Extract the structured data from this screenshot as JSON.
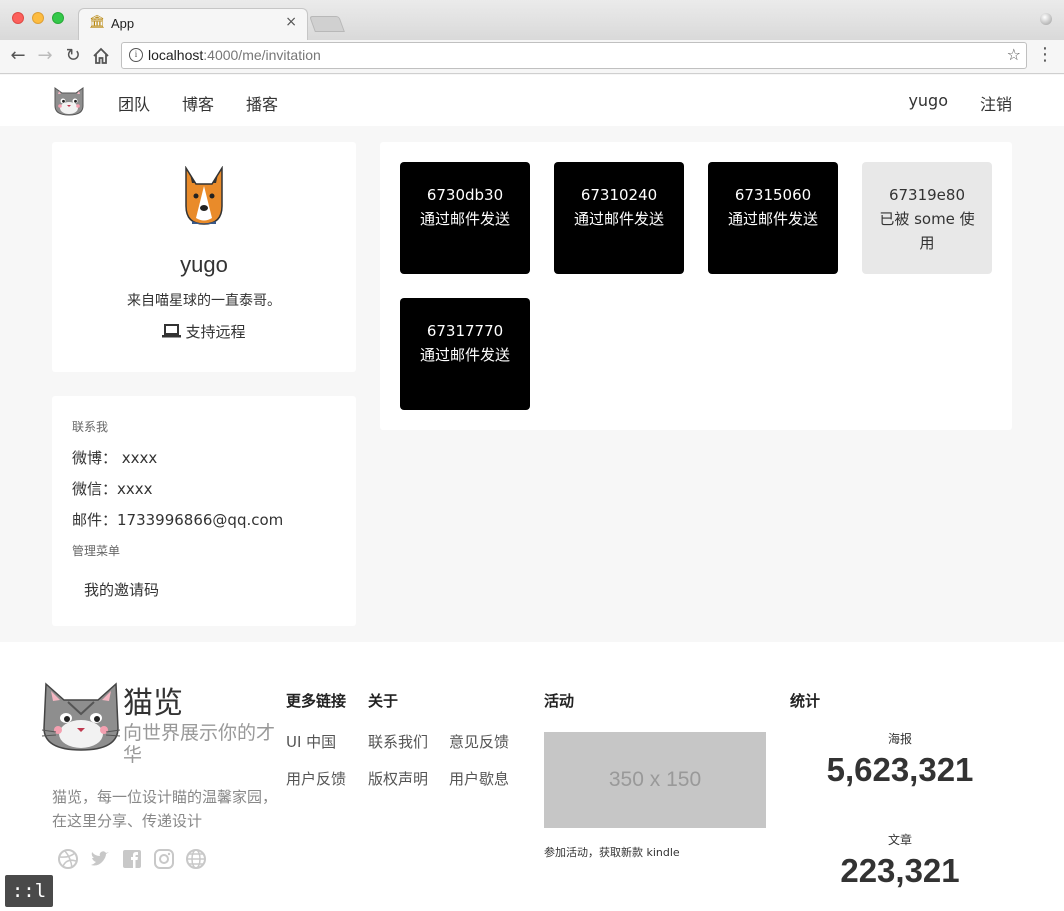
{
  "browser": {
    "tab_title": "App",
    "tab_close": "×",
    "url_host": "localhost",
    "url_path": ":4000/me/invitation"
  },
  "nav": {
    "links": [
      "团队",
      "博客",
      "播客"
    ],
    "user": "yugo",
    "logout": "注销"
  },
  "profile": {
    "name": "yugo",
    "bio": "来自喵星球的一直泰哥。",
    "remote": "支持远程"
  },
  "contact": {
    "section_label": "联系我",
    "weibo": "微博： xxxx",
    "wechat": "微信：xxxx",
    "email": "邮件：1733996866@qq.com",
    "admin_label": "管理菜单",
    "menu_item": "我的邀请码"
  },
  "invitations": [
    {
      "code": "6730db30",
      "status": "通过邮件发送",
      "used": false
    },
    {
      "code": "67310240",
      "status": "通过邮件发送",
      "used": false
    },
    {
      "code": "67315060",
      "status": "通过邮件发送",
      "used": false
    },
    {
      "code": "67319e80",
      "status": "已被 some 使用",
      "used": true
    },
    {
      "code": "67317770",
      "status": "通过邮件发送",
      "used": false
    }
  ],
  "footer": {
    "brand": "猫览",
    "tagline": "向世界展示你的才华",
    "description": "猫览，每一位设计瞄的温馨家园，在这里分享、传递设计",
    "more_links_title": "更多链接",
    "more_links": [
      "UI 中国",
      "用户反馈"
    ],
    "about_title": "关于",
    "about_links": [
      "联系我们",
      "意见反馈",
      "版权声明",
      "用户歇息"
    ],
    "activity_title": "活动",
    "ad_placeholder": "350 x 150",
    "ad_caption": "参加活动，获取新款 kindle",
    "stats_title": "统计",
    "stats": [
      {
        "label": "海报",
        "value": "5,623,321"
      },
      {
        "label": "文章",
        "value": "223,321"
      }
    ]
  },
  "badge": "::l"
}
